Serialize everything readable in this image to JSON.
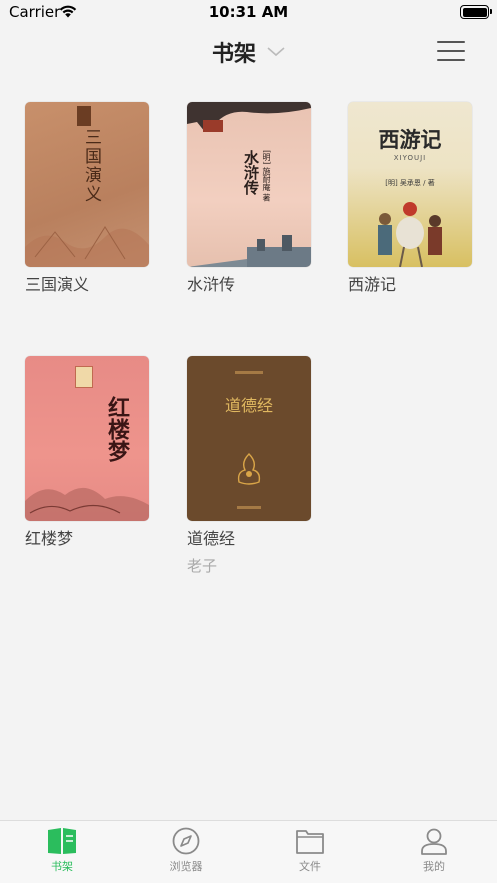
{
  "status_bar": {
    "carrier": "Carrier",
    "time": "10:31 AM"
  },
  "nav": {
    "title": "书架"
  },
  "books": [
    {
      "title": "三国演义",
      "author": "",
      "cover_text": "三国演义"
    },
    {
      "title": "水浒传",
      "author": "",
      "cover_text": "水浒传",
      "cover_sub": "[明] 施耐庵 著"
    },
    {
      "title": "西游记",
      "author": "",
      "cover_text": "西游记",
      "cover_sub": "XIYOUJI",
      "cover_credit": "[明] 吴承恩 / 著"
    },
    {
      "title": "红楼梦",
      "author": "",
      "cover_text": "红楼梦"
    },
    {
      "title": "道德经",
      "author": "老子",
      "cover_text": "道德经"
    }
  ],
  "tabs": [
    {
      "label": "书架",
      "icon": "bookshelf-icon",
      "active": true
    },
    {
      "label": "浏览器",
      "icon": "compass-icon",
      "active": false
    },
    {
      "label": "文件",
      "icon": "folder-icon",
      "active": false
    },
    {
      "label": "我的",
      "icon": "person-icon",
      "active": false
    }
  ],
  "colors": {
    "accent": "#2bbd5d",
    "background": "#f3f3f3"
  }
}
